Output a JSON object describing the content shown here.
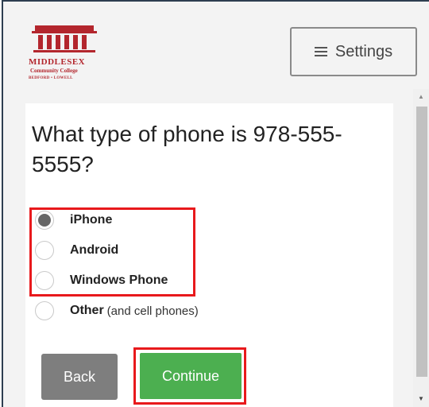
{
  "header": {
    "logo": {
      "name": "MIDDLESEX",
      "subtitle": "Community College",
      "locations": "BEDFORD • LOWELL",
      "brand_color": "#b3262d"
    },
    "settings_button": {
      "label": "Settings",
      "icon": "menu-icon"
    }
  },
  "main": {
    "question": "What type of phone is 978-555-5555?",
    "options": [
      {
        "label": "iPhone",
        "note": "",
        "checked": true
      },
      {
        "label": "Android",
        "note": "",
        "checked": false
      },
      {
        "label": "Windows Phone",
        "note": "",
        "checked": false
      },
      {
        "label": "Other",
        "note": "(and cell phones)",
        "checked": false
      }
    ],
    "back_label": "Back",
    "continue_label": "Continue"
  },
  "colors": {
    "continue": "#4caf50",
    "back": "#7e7e7e",
    "highlight": "#e8191c"
  }
}
